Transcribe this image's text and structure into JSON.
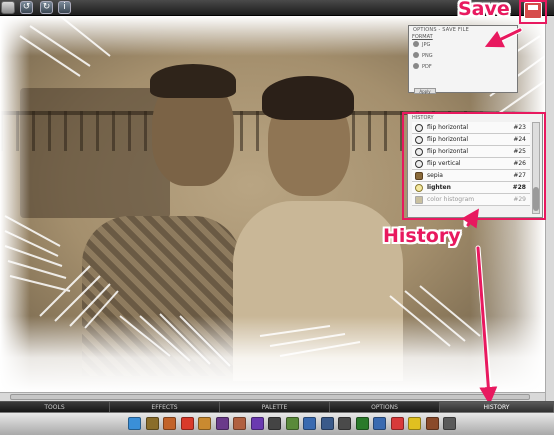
{
  "annotations": {
    "save_label": "Save",
    "history_label": "History",
    "accent_color": "#e8195f"
  },
  "toolbar": {
    "icons": [
      "open-icon",
      "undo-icon",
      "redo-icon",
      "info-icon",
      "save-icon"
    ]
  },
  "options_panel": {
    "title": "OPTIONS - SAVE FILE",
    "section": "FORMAT",
    "formats": [
      "JPG",
      "PNG",
      "PDF"
    ],
    "apply_label": "Apply"
  },
  "history_panel": {
    "title": "HISTORY",
    "items": [
      {
        "label": "flip horizontal",
        "num": "#23",
        "icon": "rotate-icon"
      },
      {
        "label": "flip horizontal",
        "num": "#24",
        "icon": "rotate-icon"
      },
      {
        "label": "flip horizontal",
        "num": "#25",
        "icon": "rotate-icon"
      },
      {
        "label": "flip vertical",
        "num": "#26",
        "icon": "rotate-icon"
      },
      {
        "label": "sepia",
        "num": "#27",
        "icon": "sepia-icon"
      },
      {
        "label": "lighten",
        "num": "#28",
        "icon": "bulb-icon"
      },
      {
        "label": "color histogram",
        "num": "#29",
        "icon": "histogram-icon"
      }
    ]
  },
  "tabs": [
    "TOOLS",
    "EFFECTS",
    "PALETTE",
    "OPTIONS",
    "HISTORY"
  ],
  "active_tab": "HISTORY",
  "bottom_icons": [
    {
      "name": "droplet-icon",
      "color": "#3a8fd8"
    },
    {
      "name": "crayon-icon",
      "color": "#8a6d2a"
    },
    {
      "name": "flame-icon",
      "color": "#c2632a"
    },
    {
      "name": "record-icon",
      "color": "#d93a2a"
    },
    {
      "name": "palette-icon",
      "color": "#c98a30"
    },
    {
      "name": "film-icon",
      "color": "#6a3a8a"
    },
    {
      "name": "brush-icon",
      "color": "#b06040"
    },
    {
      "name": "puzzle-icon",
      "color": "#6a3ab0"
    },
    {
      "name": "spider-icon",
      "color": "#444444"
    },
    {
      "name": "wand-icon",
      "color": "#5a8a3a"
    },
    {
      "name": "pen-icon",
      "color": "#3a6ab0"
    },
    {
      "name": "camera-icon",
      "color": "#3a5a8a"
    },
    {
      "name": "image-icon",
      "color": "#4a4a4a"
    },
    {
      "name": "grid-icon",
      "color": "#2a7a2a"
    },
    {
      "name": "crop-icon",
      "color": "#3a6ab0"
    },
    {
      "name": "color-bars-icon",
      "color": "#d83a3a"
    },
    {
      "name": "lightbulb-icon",
      "color": "#e0c020"
    },
    {
      "name": "gears-icon",
      "color": "#8a4a2a"
    },
    {
      "name": "stamp-icon",
      "color": "#5a5a5a"
    }
  ]
}
